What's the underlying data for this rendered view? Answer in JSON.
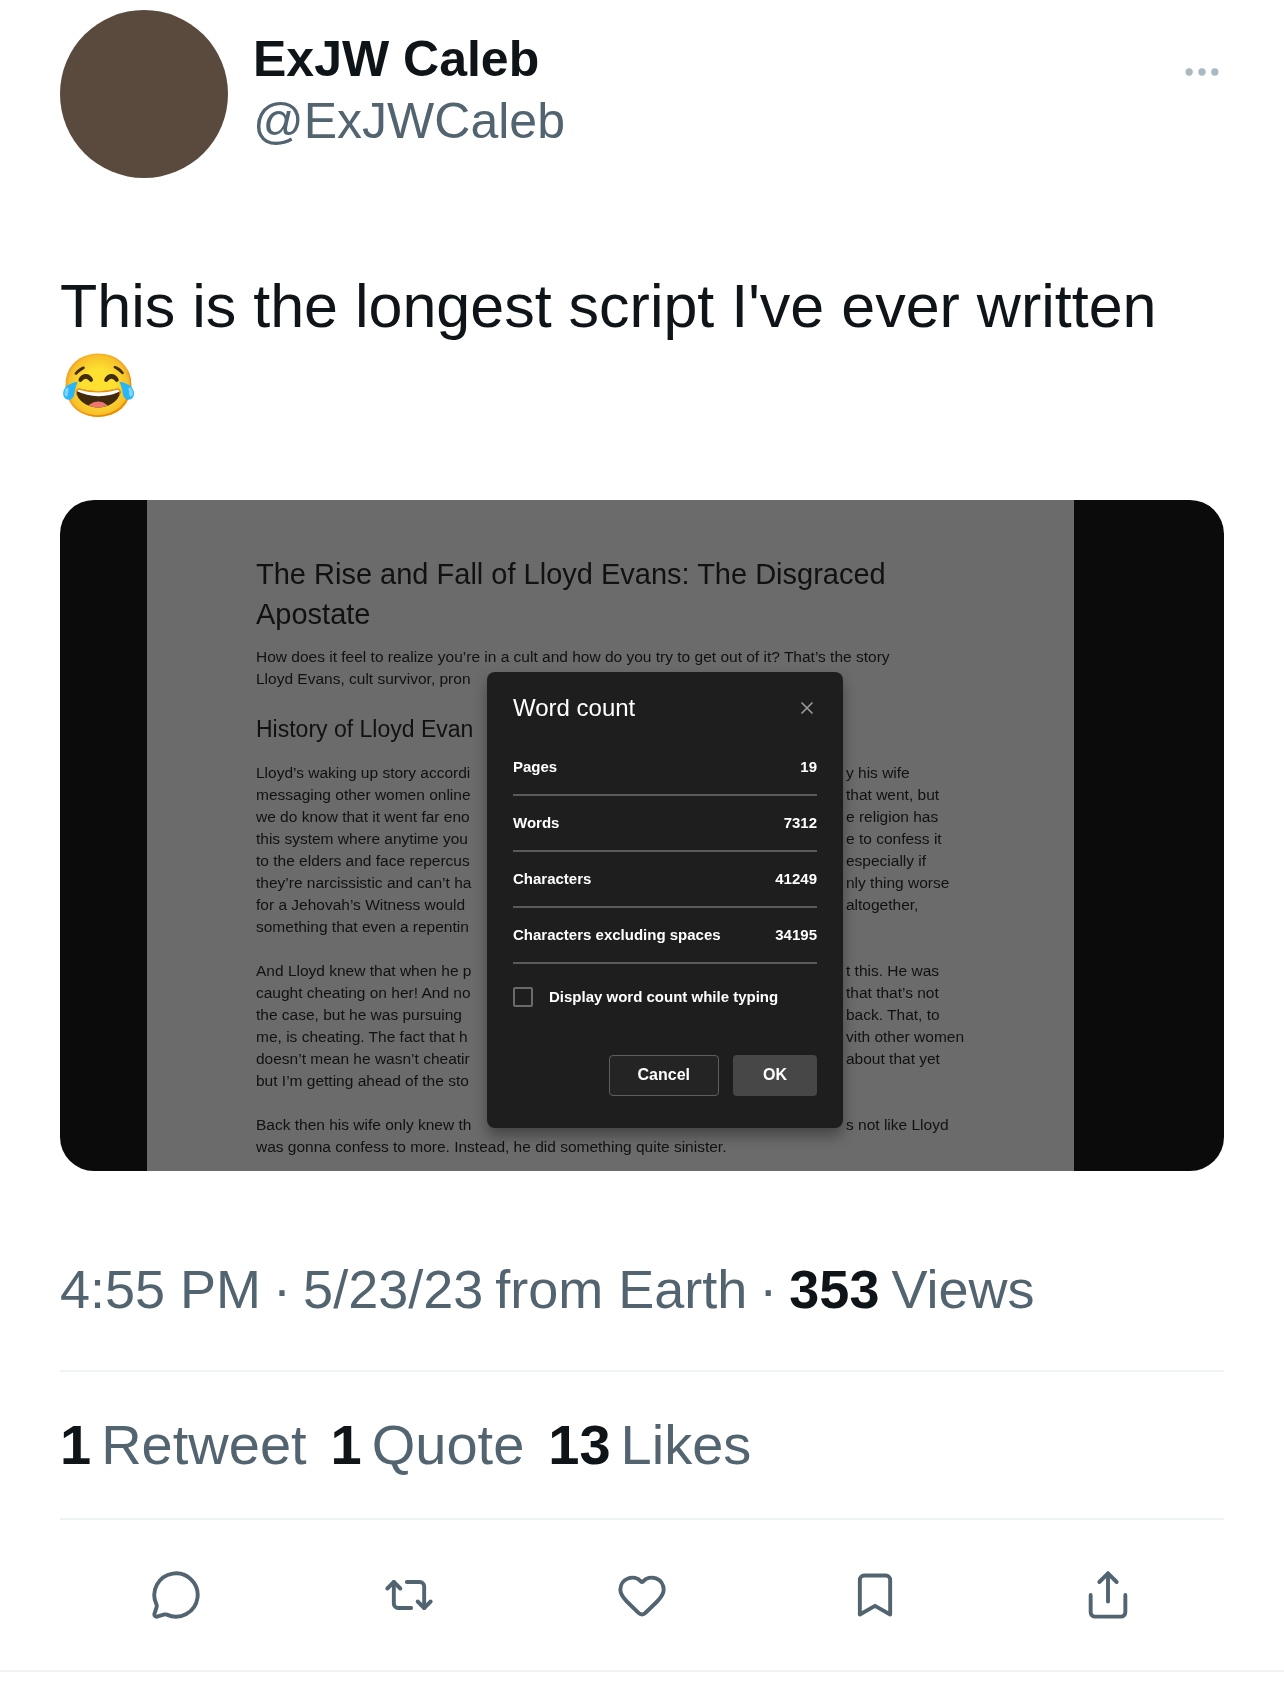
{
  "author": {
    "name": "ExJW Caleb",
    "handle": "@ExJWCaleb"
  },
  "tweet": {
    "text": "This is the longest script I've ever written",
    "emoji": "😂"
  },
  "document": {
    "title": "The Rise and Fall of Lloyd Evans: The Disgraced Apostate",
    "intro": [
      {
        "left": "How does it feel to realize you’re in a cult and how do you try to get out of it? That’s the story"
      },
      {
        "left": "Lloyd Evans, cult survivor, pron"
      }
    ],
    "heading": "History of Lloyd Evan",
    "paragraphs": [
      [
        {
          "left": "Lloyd’s waking up story accordi",
          "right": "y his wife"
        },
        {
          "left": "messaging other women online",
          "right": "that went, but"
        },
        {
          "left": "we do know that it went far eno",
          "right": "e religion has"
        },
        {
          "left": "this system where anytime you",
          "right": "e to confess it"
        },
        {
          "left": "to the elders and face repercus",
          "right": "especially if"
        },
        {
          "left": "they’re narcissistic and can’t ha",
          "right": "nly thing worse"
        },
        {
          "left": "for a Jehovah’s Witness would",
          "right": "altogether,"
        },
        {
          "left": "something that even a repentin"
        }
      ],
      [
        {
          "left": "And Lloyd knew that when he p",
          "right": "t this. He was"
        },
        {
          "left": "caught cheating on her! And no",
          "right": "that that’s not"
        },
        {
          "left": "the case, but he was pursuing",
          "right": "back. That, to"
        },
        {
          "left": "me, is cheating. The fact that h",
          "right": "vith other women"
        },
        {
          "left": "doesn’t mean he wasn’t cheatir",
          "right": "about that yet"
        },
        {
          "left": "but I’m getting ahead of the sto"
        }
      ],
      [
        {
          "left": "Back then his wife only knew th",
          "right": "s not like Lloyd"
        },
        {
          "left": "was gonna confess to more. Instead, he did something quite sinister."
        }
      ]
    ]
  },
  "dialog": {
    "title": "Word count",
    "rows": [
      {
        "label": "Pages",
        "value": "19"
      },
      {
        "label": "Words",
        "value": "7312"
      },
      {
        "label": "Characters",
        "value": "41249"
      },
      {
        "label": "Characters excluding spaces",
        "value": "34195"
      }
    ],
    "checkbox": {
      "label": "Display word count while typing",
      "checked": false
    },
    "buttons": [
      {
        "label": "Cancel",
        "kind": "secondary"
      },
      {
        "label": "OK",
        "kind": "primary"
      }
    ]
  },
  "meta": {
    "separator": "·",
    "time": "4:55 PM",
    "date": "5/23/23",
    "source": "from Earth",
    "views_count": "353",
    "views_label": "Views"
  },
  "stats": [
    {
      "count": "1",
      "label": "Retweet"
    },
    {
      "count": "1",
      "label": "Quote"
    },
    {
      "count": "13",
      "label": "Likes"
    }
  ],
  "actions": [
    {
      "kind": "reply"
    },
    {
      "kind": "retweet"
    },
    {
      "kind": "like"
    },
    {
      "kind": "bookmark"
    },
    {
      "kind": "share"
    }
  ]
}
